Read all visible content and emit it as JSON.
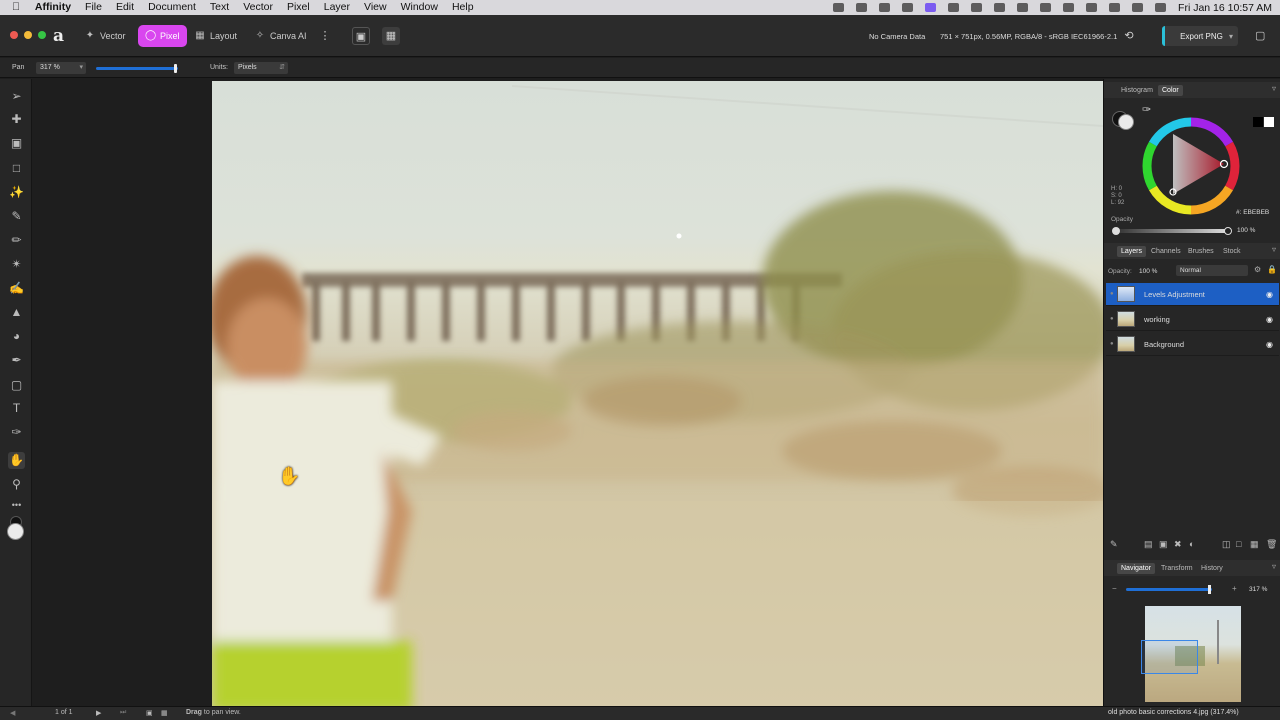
{
  "menubar": {
    "app_name": "Affinity",
    "items": [
      "File",
      "Edit",
      "Document",
      "Text",
      "Vector",
      "Pixel",
      "Layer",
      "View",
      "Window",
      "Help"
    ],
    "clock": "Fri Jan 16  10:57 AM"
  },
  "toolbar": {
    "personas": [
      "Vector",
      "Pixel",
      "Layout",
      "Canva AI"
    ],
    "selected_persona": "Pixel",
    "camera": "No Camera Data",
    "doc_info": "751 × 751px, 0.56MP, RGBA/8 - sRGB IEC61966-2.1",
    "export_label": "Export PNG"
  },
  "context": {
    "tool_label": "Pan",
    "zoom_value": "317 %",
    "units_label": "Units:",
    "units_value": "Pixels"
  },
  "color_panel": {
    "tabs": [
      "Histogram",
      "Color"
    ],
    "selected_tab": "Color",
    "hsl": [
      "H: 0",
      "S: 0",
      "L: 92"
    ],
    "hex": "#: EBEBEB",
    "opacity_label": "Opacity",
    "opacity_value": "100 %",
    "accent": "#e0233a"
  },
  "layers_panel": {
    "tabs": [
      "Layers",
      "Channels",
      "Brushes",
      "Stock"
    ],
    "selected_tab": "Layers",
    "opacity_label": "Opacity:",
    "opacity_value": "100 %",
    "blend_mode": "Normal",
    "layers": [
      {
        "name": "Levels Adjustment",
        "selected": true
      },
      {
        "name": "working",
        "selected": false
      },
      {
        "name": "Background",
        "selected": false
      }
    ]
  },
  "navigator_panel": {
    "tabs": [
      "Navigator",
      "Transform",
      "History"
    ],
    "selected_tab": "Navigator",
    "zoom_value": "317 %"
  },
  "statusbar": {
    "page": "1 of 1",
    "hint_bold": "Drag",
    "hint_rest": "to pan view.",
    "filename": "old photo basic corrections 4.jpg (317.4%)"
  },
  "colors": {
    "selection_blue": "#1d5fc4",
    "persona_pink": "#d946ef",
    "export_accent": "#2bc0d8"
  }
}
